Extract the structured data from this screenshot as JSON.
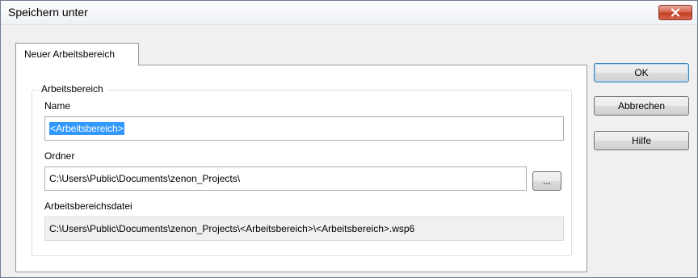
{
  "dialog": {
    "title": "Speichern unter",
    "close_icon": "close-icon"
  },
  "tabs": [
    {
      "label": "Neuer Arbeitsbereich",
      "active": true
    }
  ],
  "group": {
    "legend": "Arbeitsbereich",
    "name": {
      "label": "Name",
      "value": "<Arbeitsbereich>"
    },
    "folder": {
      "label": "Ordner",
      "value": "C:\\Users\\Public\\Documents\\zenon_Projects\\",
      "browse_label": "..."
    },
    "file": {
      "label": "Arbeitsbereichsdatei",
      "value": "C:\\Users\\Public\\Documents\\zenon_Projects\\<Arbeitsbereich>\\<Arbeitsbereich>.wsp6"
    }
  },
  "buttons": {
    "ok": "OK",
    "cancel": "Abbrechen",
    "help": "Hilfe"
  },
  "colors": {
    "selection": "#3399ff",
    "close_button": "#c7432b"
  }
}
